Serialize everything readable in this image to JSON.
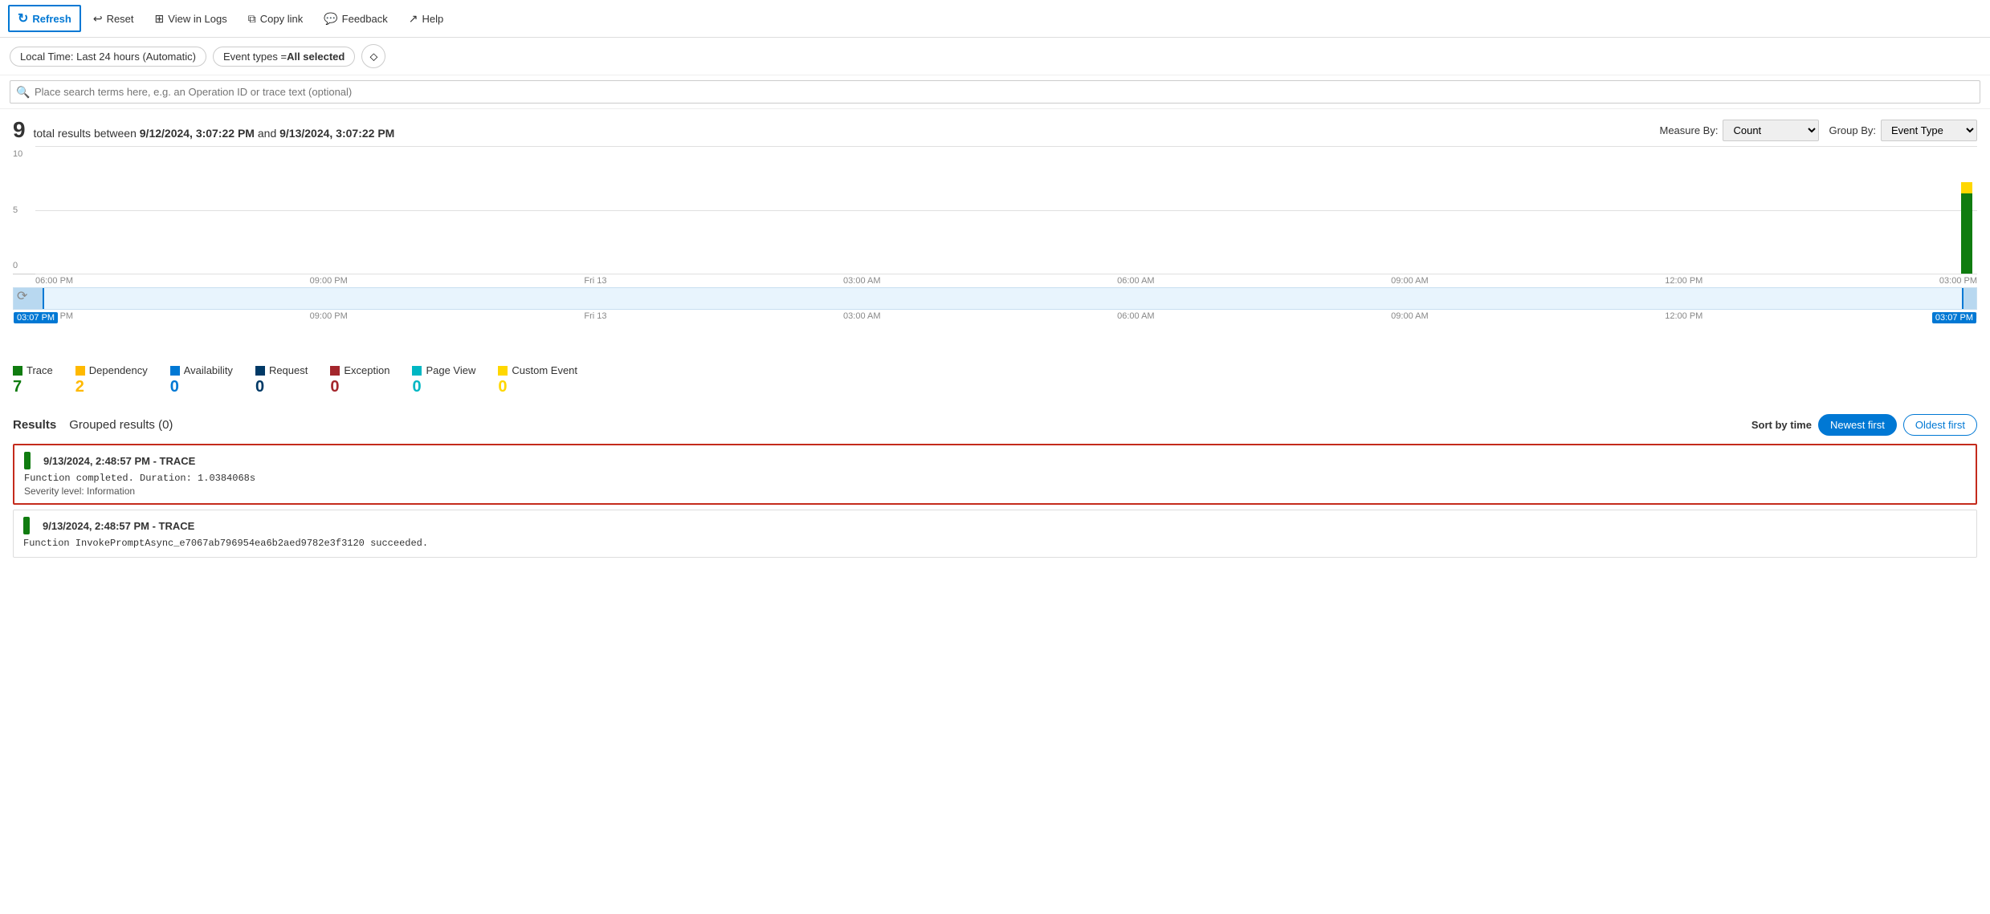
{
  "toolbar": {
    "refresh_label": "Refresh",
    "reset_label": "Reset",
    "view_in_logs_label": "View in Logs",
    "copy_link_label": "Copy link",
    "feedback_label": "Feedback",
    "help_label": "Help"
  },
  "filters": {
    "time_label": "Local Time: Last 24 hours (Automatic)",
    "event_types_label": "Event types = ",
    "event_types_value": "All selected"
  },
  "search": {
    "placeholder": "Place search terms here, e.g. an Operation ID or trace text (optional)"
  },
  "summary": {
    "count": "9",
    "description": "total results between",
    "start_time": "9/12/2024, 3:07:22 PM",
    "end_time": "9/13/2024, 3:07:22 PM",
    "measure_by_label": "Measure By:",
    "measure_by_value": "Count",
    "group_by_label": "Group By:",
    "group_by_value": "Event Type"
  },
  "chart": {
    "y_labels": [
      "10",
      "5",
      "0"
    ],
    "x_labels": [
      "06:00 PM",
      "09:00 PM",
      "Fri 13",
      "03:00 AM",
      "06:00 AM",
      "09:00 AM",
      "12:00 PM",
      "03:00 PM"
    ],
    "bar_green_height": 120,
    "bar_yellow_height": 20,
    "scrubber_x_labels": [
      "06:00 PM",
      "09:00 PM",
      "Fri 13",
      "03:00 AM",
      "06:00 AM",
      "09:00 AM",
      "12:00 PM",
      "03:00 PM"
    ],
    "time_start": "03:07 PM",
    "time_end": "03:07 PM"
  },
  "legend": {
    "items": [
      {
        "label": "Trace",
        "color": "#107c10",
        "count": "7"
      },
      {
        "label": "Dependency",
        "color": "#ffb900",
        "count": "2"
      },
      {
        "label": "Availability",
        "color": "#0078d4",
        "count": "0"
      },
      {
        "label": "Request",
        "color": "#003966",
        "count": "0"
      },
      {
        "label": "Exception",
        "color": "#a4262c",
        "count": "0"
      },
      {
        "label": "Page View",
        "color": "#00b7c3",
        "count": "0"
      },
      {
        "label": "Custom Event",
        "color": "#ffd700",
        "count": "0"
      }
    ]
  },
  "results": {
    "title": "Results",
    "grouped_label": "Grouped results (0)",
    "sort_label": "Sort by time",
    "newest_label": "Newest first",
    "oldest_label": "Oldest first",
    "items": [
      {
        "id": "result-1",
        "selected": true,
        "color": "#107c10",
        "header": "9/13/2024, 2:48:57 PM - TRACE",
        "body": "Function completed. Duration: 1.0384068s",
        "meta": "Severity level: Information"
      },
      {
        "id": "result-2",
        "selected": false,
        "color": "#107c10",
        "header": "9/13/2024, 2:48:57 PM - TRACE",
        "body": "Function InvokePromptAsync_e7067ab796954ea6b2aed9782e3f3120 succeeded.",
        "meta": ""
      }
    ]
  }
}
